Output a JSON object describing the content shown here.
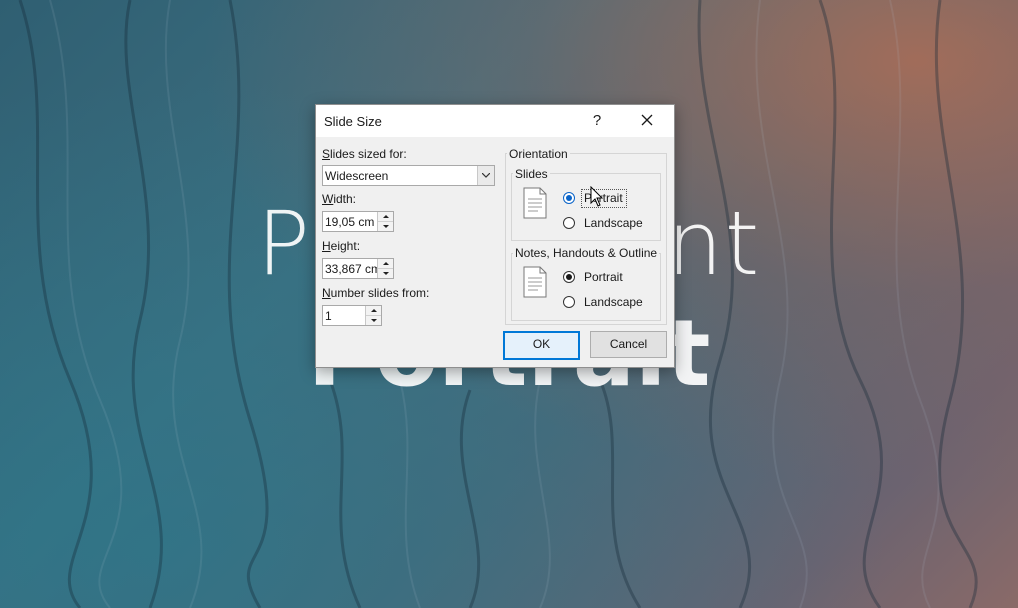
{
  "background": {
    "title_line1": "PowerPoint",
    "title_line2": "Portrait"
  },
  "dialog": {
    "title": "Slide Size",
    "help_label": "?",
    "slides_sized_for": {
      "label_prefix": "",
      "label_access": "S",
      "label_rest": "lides sized for:",
      "value": "Widescreen"
    },
    "width": {
      "label_access": "W",
      "label_rest": "idth:",
      "value": "19,05 cm"
    },
    "height": {
      "label_access": "H",
      "label_rest": "eight:",
      "value": "33,867 cm"
    },
    "number_slides_from": {
      "label_access": "N",
      "label_rest": "umber slides from:",
      "value": "1"
    },
    "orientation": {
      "legend": "Orientation",
      "slides": {
        "legend": "Slides",
        "options": [
          {
            "label": "Portrait",
            "selected": true
          },
          {
            "label": "Landscape",
            "selected": false
          }
        ]
      },
      "notes": {
        "legend": "Notes, Handouts & Outline",
        "options": [
          {
            "label": "Portrait",
            "selected": true
          },
          {
            "label": "Landscape",
            "selected": false
          }
        ]
      }
    },
    "ok_label": "OK",
    "cancel_label": "Cancel"
  },
  "colors": {
    "accent": "#0078d7",
    "radio_selected_blue": "#0a64c8",
    "dialog_bg": "#f0f0f0"
  },
  "icons": [
    "close-icon",
    "dropdown-arrow-icon",
    "spin-up-icon",
    "spin-down-icon",
    "slide-document-icon",
    "mouse-cursor-icon"
  ]
}
